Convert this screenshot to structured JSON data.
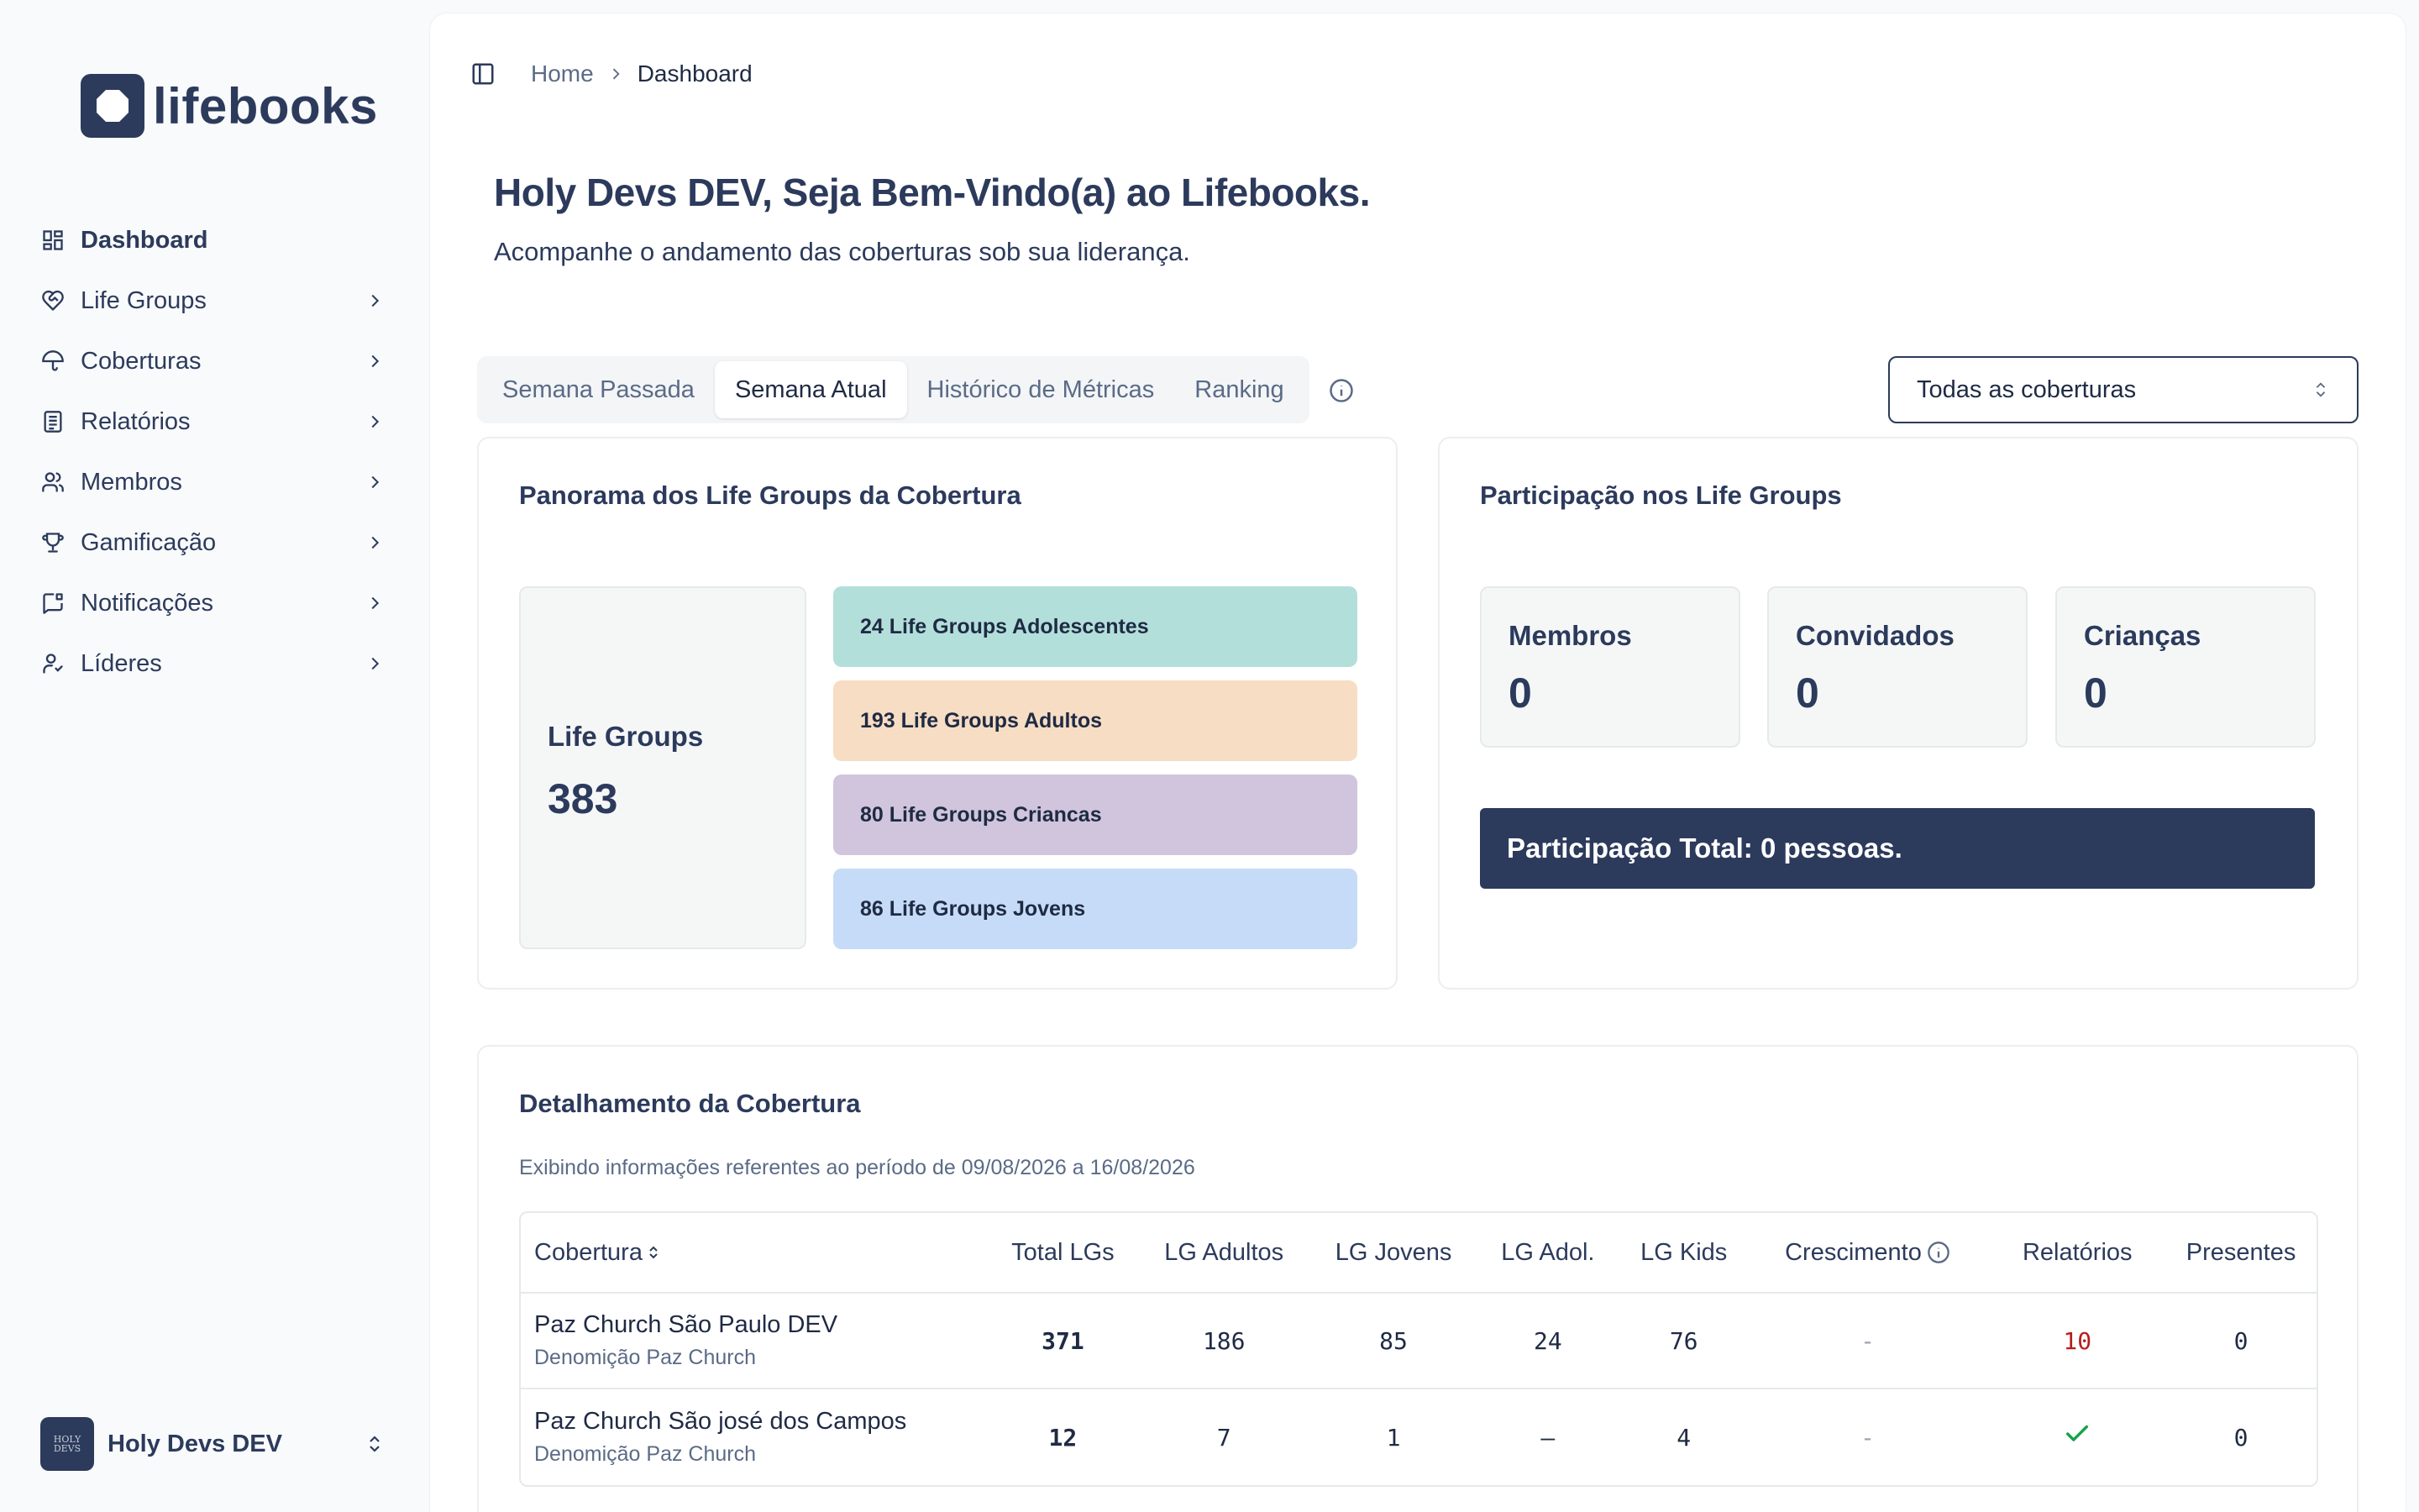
{
  "app": {
    "logo_text": "lifebooks"
  },
  "sidebar": {
    "items": [
      {
        "label": "Dashboard",
        "icon": "dashboard-icon",
        "active": true,
        "has_chevron": false
      },
      {
        "label": "Life Groups",
        "icon": "heart-handshake-icon",
        "has_chevron": true
      },
      {
        "label": "Coberturas",
        "icon": "umbrella-icon",
        "has_chevron": true
      },
      {
        "label": "Relatórios",
        "icon": "report-icon",
        "has_chevron": true
      },
      {
        "label": "Membros",
        "icon": "users-icon",
        "has_chevron": true
      },
      {
        "label": "Gamificação",
        "icon": "trophy-icon",
        "has_chevron": true
      },
      {
        "label": "Notificações",
        "icon": "message-flag-icon",
        "has_chevron": true
      },
      {
        "label": "Líderes",
        "icon": "user-leader-icon",
        "has_chevron": true
      }
    ],
    "user": {
      "name": "Holy Devs DEV",
      "avatar_text": "HOLY DEVS"
    }
  },
  "topbar": {
    "breadcrumb": [
      "Home",
      "Dashboard"
    ]
  },
  "header": {
    "title": "Holy Devs DEV, Seja Bem-Vindo(a) ao Lifebooks.",
    "subtitle": "Acompanhe o andamento das coberturas sob sua liderança."
  },
  "tabs": [
    {
      "label": "Semana Passada",
      "active": false
    },
    {
      "label": "Semana Atual",
      "active": true
    },
    {
      "label": "Histórico de Métricas",
      "active": false
    },
    {
      "label": "Ranking",
      "active": false
    }
  ],
  "filter": {
    "selected": "Todas as coberturas"
  },
  "panorama": {
    "title": "Panorama dos Life Groups da Cobertura",
    "total_label": "Life Groups",
    "total_value": "383",
    "groups": [
      {
        "label": "24 Life Groups Adolescentes",
        "color": "#b3dfda"
      },
      {
        "label": "193 Life Groups Adultos",
        "color": "#f7ddc3"
      },
      {
        "label": "80 Life Groups Criancas",
        "color": "#d0c5dc"
      },
      {
        "label": "86 Life Groups Jovens",
        "color": "#c6dbf7"
      }
    ]
  },
  "participacao": {
    "title": "Participação nos Life Groups",
    "stats": [
      {
        "label": "Membros",
        "value": "0"
      },
      {
        "label": "Convidados",
        "value": "0"
      },
      {
        "label": "Crianças",
        "value": "0"
      }
    ],
    "total": "Participação Total: 0 pessoas."
  },
  "detalhamento": {
    "title": "Detalhamento da Cobertura",
    "subtitle": "Exibindo informações referentes ao período de 09/08/2026 a 16/08/2026",
    "columns": [
      "Cobertura",
      "Total LGs",
      "LG Adultos",
      "LG Jovens",
      "LG Adol.",
      "LG Kids",
      "Crescimento",
      "Relatórios",
      "Presentes"
    ],
    "rows": [
      {
        "name": "Paz Church São Paulo DEV",
        "sub": "Denomição Paz Church",
        "total": "371",
        "adultos": "186",
        "jovens": "85",
        "adol": "24",
        "kids": "76",
        "crescimento": "-",
        "relatorios": "10",
        "presentes": "0"
      },
      {
        "name": "Paz Church São josé dos Campos",
        "sub": "Denomição Paz Church",
        "total": "12",
        "adultos": "7",
        "jovens": "1",
        "adol": "–",
        "kids": "4",
        "crescimento": "-",
        "relatorios": "check",
        "presentes": "0"
      }
    ]
  }
}
